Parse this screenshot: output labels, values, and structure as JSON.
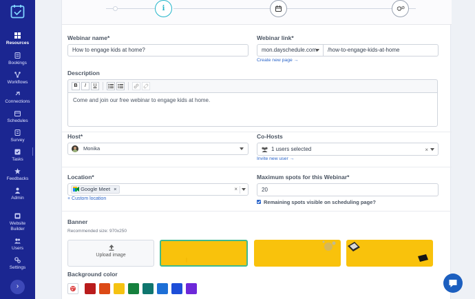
{
  "sidebar": {
    "items": [
      {
        "label": "Resources",
        "icon": "grid-icon",
        "active": true
      },
      {
        "label": "Bookings",
        "icon": "bookings-icon"
      },
      {
        "label": "Workflows",
        "icon": "workflow-icon"
      },
      {
        "label": "Connections",
        "icon": "connections-icon"
      },
      {
        "label": "Schedules",
        "icon": "schedules-icon"
      },
      {
        "label": "Survey",
        "icon": "survey-icon"
      },
      {
        "label": "Tasks",
        "icon": "tasks-icon"
      },
      {
        "label": "Feedbacks",
        "icon": "star-icon"
      },
      {
        "label": "Admin",
        "icon": "admin-icon"
      },
      {
        "label": "Website Builder",
        "icon": "website-icon"
      },
      {
        "label": "Users",
        "icon": "users-icon"
      },
      {
        "label": "Settings",
        "icon": "settings-icon"
      }
    ],
    "collapse_label": "›"
  },
  "stepper": {
    "steps": [
      {
        "icon": "info-icon",
        "label": "i",
        "active": true
      },
      {
        "icon": "calendar-icon"
      },
      {
        "icon": "gears-icon"
      }
    ]
  },
  "form": {
    "webinar_name": {
      "label": "Webinar name*",
      "value": "How to engage kids at home?"
    },
    "webinar_link": {
      "label": "Webinar link*",
      "domain": "mon.dayschedule.com",
      "path": "/how-to-engage-kids-at-home",
      "create_link": "Create new page →"
    },
    "description": {
      "label": "Description",
      "value": "Come and join our free webinar to engage kids at home.",
      "toolbar": [
        "B",
        "I",
        "U"
      ]
    },
    "host": {
      "label": "Host*",
      "value": "Monika"
    },
    "cohosts": {
      "label": "Co-Hosts",
      "value": "1 users selected",
      "invite_link": "Invite new user →"
    },
    "location": {
      "label": "Location*",
      "chip": "Google Meet",
      "chip_remove": "×",
      "custom_link": "+ Custom location"
    },
    "max_spots": {
      "label": "Maximum spots for this Webinar*",
      "value": "20"
    },
    "remaining_visible": {
      "label": "Remaining spots visible on scheduling page?",
      "checked": true
    },
    "banner": {
      "label": "Banner",
      "recommended": "Recommended size: 970x250",
      "upload_label": "Upload image",
      "selected_index": 0
    },
    "background": {
      "label": "Background color",
      "colors": [
        "#b91c1c",
        "#dc4a16",
        "#f5c211",
        "#15803d",
        "#0f766e",
        "#1d6fd6",
        "#1d4ed8",
        "#6d28d9"
      ]
    }
  },
  "colors": {
    "sidebar": "#1b2691",
    "accent": "#22b5c9",
    "banner_yellow": "#f9c20c",
    "link": "#2a64c9"
  }
}
